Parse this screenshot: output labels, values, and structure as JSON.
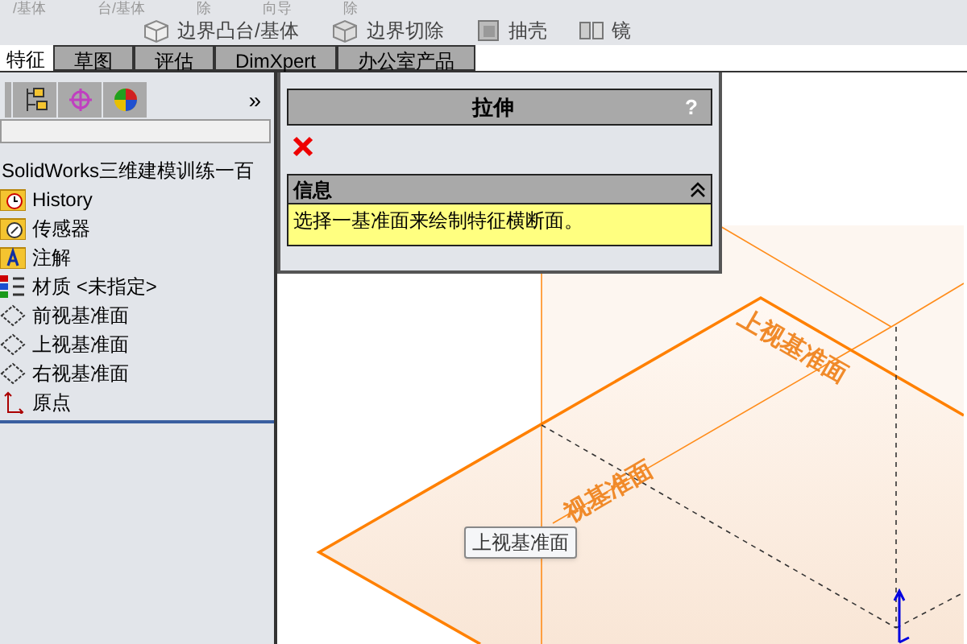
{
  "toolbar": {
    "top_row": [
      "/基体",
      "台/基体",
      "除",
      "向导",
      "除"
    ],
    "buttons": [
      {
        "label": "边界凸台/基体",
        "kind": "boss"
      },
      {
        "label": "边界切除",
        "kind": "cut"
      },
      {
        "label": "抽壳",
        "kind": "shell"
      },
      {
        "label": "镜",
        "kind": "mirror"
      }
    ]
  },
  "tabs": [
    {
      "label": "特征",
      "selected": true
    },
    {
      "label": "草图",
      "selected": false
    },
    {
      "label": "评估",
      "selected": false
    },
    {
      "label": "DimXpert",
      "selected": false
    },
    {
      "label": "办公室产品",
      "selected": false
    }
  ],
  "feature_manager": {
    "more": "»",
    "tree": {
      "root": "SolidWorks三维建模训练一百",
      "items": [
        {
          "label": "History",
          "kind": "history"
        },
        {
          "label": "传感器",
          "kind": "sensor"
        },
        {
          "label": "注解",
          "kind": "annotation"
        },
        {
          "label": "材质 <未指定>",
          "kind": "material"
        },
        {
          "label": "前视基准面",
          "kind": "plane"
        },
        {
          "label": "上视基准面",
          "kind": "plane"
        },
        {
          "label": "右视基准面",
          "kind": "plane"
        },
        {
          "label": "原点",
          "kind": "origin"
        }
      ]
    }
  },
  "property_manager": {
    "title": "拉伸",
    "help": "?",
    "info": {
      "title": "信息",
      "expanded": true,
      "message": "选择一基准面来绘制特征横断面。"
    }
  },
  "viewport": {
    "plane_labels": [
      "上视基准面",
      "视基准面"
    ],
    "tooltip": "上视基准面"
  }
}
